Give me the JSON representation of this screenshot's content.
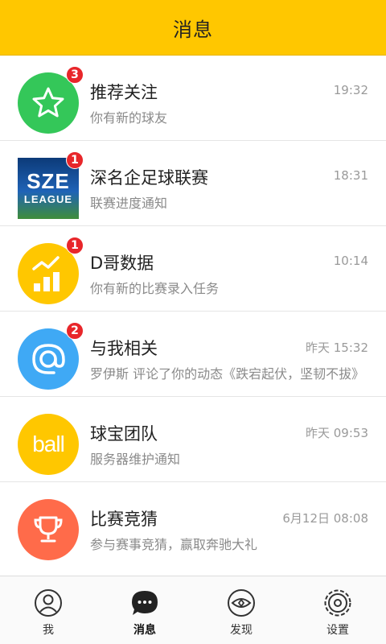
{
  "header": {
    "title": "消息"
  },
  "conversations": [
    {
      "name": "推荐关注",
      "time": "19:32",
      "preview": "你有新的球友",
      "badge": "3",
      "avatar_icon": "star-icon",
      "avatar_color": "#34c759"
    },
    {
      "name": "深名企足球联赛",
      "time": "18:31",
      "preview": "联赛进度通知",
      "badge": "1",
      "avatar_icon": "sze-league-logo",
      "logo_line1": "SZE",
      "logo_line2": "LEAGUE"
    },
    {
      "name": "D哥数据",
      "time": "10:14",
      "preview": "你有新的比赛录入任务",
      "badge": "1",
      "avatar_icon": "chart-icon",
      "avatar_color": "#ffc700"
    },
    {
      "name": "与我相关",
      "time": "昨天 15:32",
      "preview": "罗伊斯 评论了你的动态《跌宕起伏，坚韧不拔》",
      "badge": "2",
      "avatar_icon": "at-icon",
      "avatar_color": "#3fa9f5"
    },
    {
      "name": "球宝团队",
      "time": "昨天 09:53",
      "preview": "服务器维护通知",
      "avatar_icon": "ball-logo-icon",
      "avatar_text": "ball",
      "avatar_color": "#ffc700"
    },
    {
      "name": "比赛竞猜",
      "time": "6月12日 08:08",
      "preview": "参与赛事竞猜，赢取奔驰大礼",
      "avatar_icon": "trophy-icon",
      "avatar_color": "#ff6b4a"
    }
  ],
  "tabbar": {
    "tabs": [
      {
        "label": "我",
        "icon": "profile-icon"
      },
      {
        "label": "消息",
        "icon": "chat-icon",
        "active": true
      },
      {
        "label": "发现",
        "icon": "eye-icon"
      },
      {
        "label": "设置",
        "icon": "gear-icon"
      }
    ]
  }
}
